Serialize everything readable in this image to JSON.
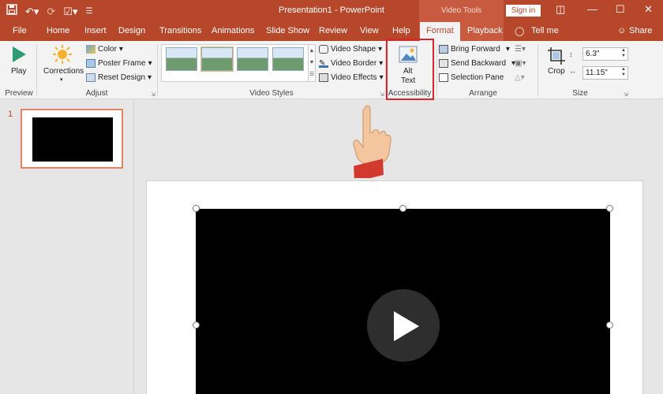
{
  "titlebar": {
    "title": "Presentation1  -  PowerPoint",
    "context_group": "Video Tools",
    "sign_in": "Sign in",
    "qat_icons": [
      "save-icon",
      "undo-icon",
      "redo-icon",
      "touch-mode-icon",
      "customize-icon"
    ]
  },
  "tabs": [
    "File",
    "Home",
    "Insert",
    "Design",
    "Transitions",
    "Animations",
    "Slide Show",
    "Review",
    "View",
    "Help",
    "Format",
    "Playback"
  ],
  "active_tab": "Format",
  "tell_me": "Tell me",
  "share": "Share",
  "ribbon": {
    "preview": {
      "play": "Play",
      "group": "Preview"
    },
    "adjust": {
      "corrections": "Corrections",
      "color": "Color",
      "poster_frame": "Poster Frame",
      "reset_design": "Reset Design",
      "group": "Adjust"
    },
    "video_styles": {
      "video_shape": "Video Shape",
      "video_border": "Video Border",
      "video_effects": "Video Effects",
      "group": "Video Styles"
    },
    "accessibility": {
      "alt_text_line1": "Alt",
      "alt_text_line2": "Text",
      "group": "Accessibility"
    },
    "arrange": {
      "bring_forward": "Bring Forward",
      "send_backward": "Send Backward",
      "selection_pane": "Selection Pane",
      "group": "Arrange"
    },
    "size": {
      "crop": "Crop",
      "height": "6.3\"",
      "width": "11.15\"",
      "group": "Size"
    }
  },
  "slides": {
    "current_number": "1"
  },
  "colors": {
    "accent": "#b7472a",
    "highlight": "#d9262e"
  }
}
